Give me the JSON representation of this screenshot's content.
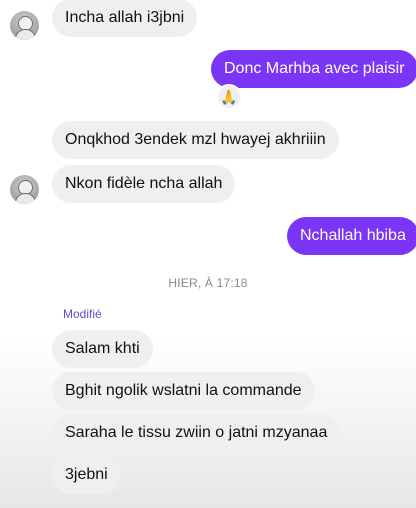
{
  "messages": {
    "m1": {
      "text": "Incha allah i3jbni"
    },
    "m2": {
      "text": "Donc Marhba avec plaisir",
      "reaction": "🙏"
    },
    "m3": {
      "text": "Onqkhod 3endek mzl hwayej akhriiin"
    },
    "m4": {
      "text": "Nkon fidèle ncha allah"
    },
    "m5": {
      "text": "Nchallah hbiba"
    },
    "timestamp": "HIER, À 17:18",
    "edited_label": "Modifié",
    "m6": {
      "text": "Salam khti"
    },
    "m7": {
      "text": "Bghit ngolik wslatni la commande"
    },
    "m8": {
      "text": "Saraha le tissu zwiin o jatni mzyanaa"
    },
    "m9": {
      "text": "3jebni"
    }
  },
  "colors": {
    "outgoing": "#7b35f6",
    "incoming": "#efeff1",
    "edited": "#5a4ec7"
  },
  "icons": {
    "avatar": "user-avatar-icon",
    "reaction": "folded-hands-emoji"
  }
}
